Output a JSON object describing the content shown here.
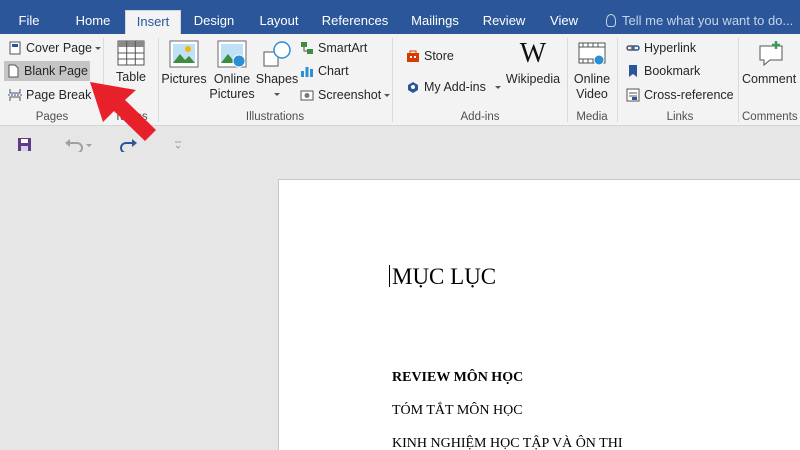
{
  "tabs": [
    {
      "label": "File"
    },
    {
      "label": "Home"
    },
    {
      "label": "Insert"
    },
    {
      "label": "Design"
    },
    {
      "label": "Layout"
    },
    {
      "label": "References"
    },
    {
      "label": "Mailings"
    },
    {
      "label": "Review"
    },
    {
      "label": "View"
    }
  ],
  "active_tab": "Insert",
  "tell_me": "Tell me what you want to do...",
  "groups": {
    "pages": {
      "label": "Pages",
      "cover_page": "Cover Page",
      "blank_page": "Blank Page",
      "page_break": "Page Break"
    },
    "tables": {
      "label": "Tables",
      "table": "Table"
    },
    "illustrations": {
      "label": "Illustrations",
      "pictures": "Pictures",
      "online_pictures_1": "Online",
      "online_pictures_2": "Pictures",
      "shapes": "Shapes",
      "smartart": "SmartArt",
      "chart": "Chart",
      "screenshot": "Screenshot"
    },
    "addins": {
      "label": "Add-ins",
      "store": "Store",
      "my_addins": "My Add-ins",
      "wikipedia": "Wikipedia",
      "wiki_glyph": "W"
    },
    "media": {
      "label": "Media",
      "online_video_1": "Online",
      "online_video_2": "Video"
    },
    "links": {
      "label": "Links",
      "hyperlink": "Hyperlink",
      "bookmark": "Bookmark",
      "cross_reference": "Cross-reference"
    },
    "comments": {
      "label": "Comments",
      "comment": "Comment"
    }
  },
  "document": {
    "heading": "MỤC LỤC",
    "lines": [
      "REVIEW MÔN HỌC",
      "TÓM TẮT MÔN HỌC",
      "KINH NGHIỆM HỌC TẬP VÀ ÔN THI"
    ]
  },
  "colors": {
    "ribbon_blue": "#2b579a",
    "arrow_red": "#e8202a",
    "highlight": "#c5c5c5"
  }
}
